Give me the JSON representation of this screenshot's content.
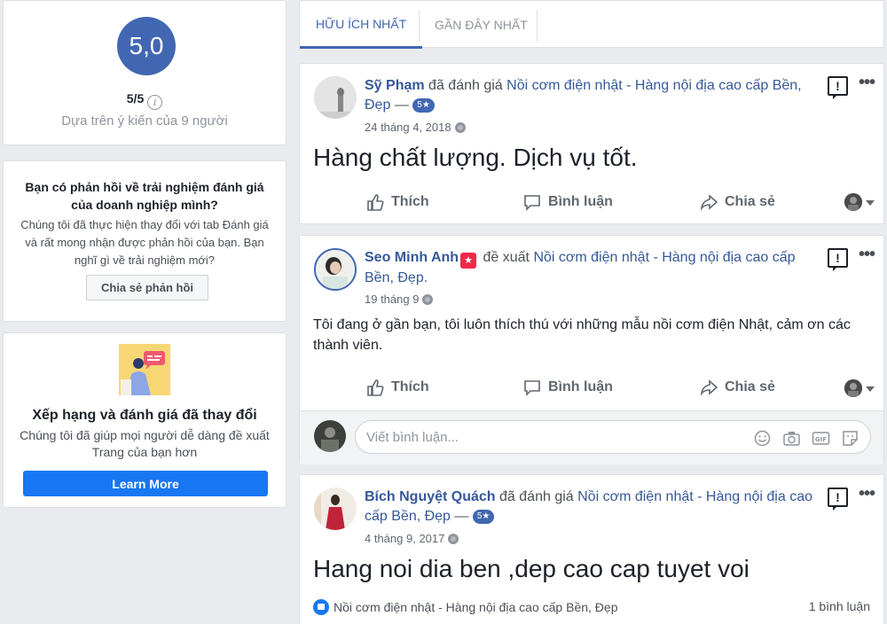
{
  "rating_summary": {
    "score": "5,0",
    "score_out_of": "5/5",
    "based_on": "Dựa trên ý kiến của 9 người"
  },
  "feedback_card": {
    "title": "Bạn có phản hồi về trải nghiệm đánh giá của doanh nghiệp mình?",
    "body": "Chúng tôi đã thực hiện thay đổi với tab Đánh giá và rất mong nhận được phản hồi của bạn. Bạn nghĩ gì về trải nghiệm mới?",
    "button_label": "Chia sẻ phản hồi"
  },
  "changes_card": {
    "title": "Xếp hạng và đánh giá đã thay đổi",
    "body": "Chúng tôi đã giúp mọi người dễ dàng đề xuất Trang của bạn hơn",
    "button_label": "Learn More"
  },
  "tabs": [
    {
      "label": "HỮU ÍCH NHẤT",
      "active": true
    },
    {
      "label": "GẦN ĐÂY NHẤT",
      "active": false
    }
  ],
  "actions": {
    "like": "Thích",
    "comment": "Bình luận",
    "share": "Chia sẻ"
  },
  "posts": [
    {
      "author": "Sỹ Phạm",
      "verb": "đã đánh giá",
      "target": "Nồi cơm điện nhật - Hàng nội địa cao cấp Bền, Đẹp",
      "separator": "—",
      "rating": "5★",
      "date": "24 tháng 4, 2018",
      "text": "Hàng chất lượng. Dịch vụ tốt."
    },
    {
      "author": "Seo Minh Anh",
      "verb": "đề xuất",
      "target": "Nồi cơm điện nhật - Hàng nội địa cao cấp Bền, Đẹp.",
      "date": "19 tháng 9",
      "text": "Tôi đang ở gần bạn, tôi luôn thích thú với những mẫu nồi cơm điện Nhật, cảm ơn các thành viên.",
      "comment_placeholder": "Viết bình luận..."
    },
    {
      "author": "Bích Nguyệt Quách",
      "verb": "đã đánh giá",
      "target": "Nồi cơm điện nhật - Hàng nội địa cao cấp Bền, Đẹp",
      "separator": "—",
      "rating": "5★",
      "date": "4 tháng 9, 2017",
      "text": "Hang noi dia ben ,dep cao cap tuyet voi",
      "like_page": "Nồi cơm điện nhật - Hàng nội địa cao cấp Bền, Đẹp",
      "comment_count": "1 bình luận"
    }
  ],
  "colors": {
    "accent": "#4267b2",
    "link": "#365899",
    "button_blue": "#1877f2",
    "background": "#e9ebee"
  }
}
